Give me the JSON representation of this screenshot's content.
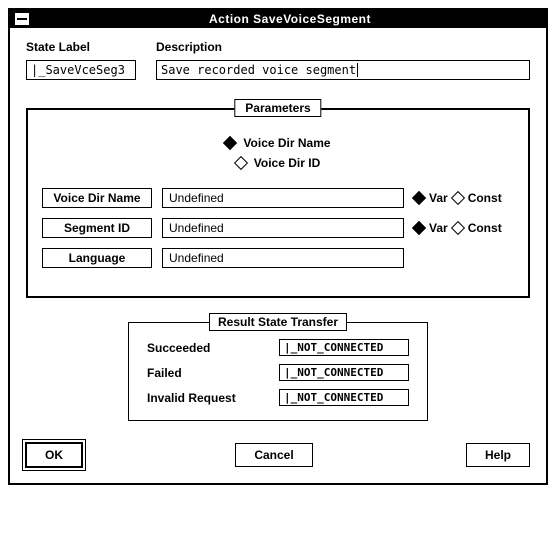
{
  "window": {
    "title": "Action SaveVoiceSegment"
  },
  "headers": {
    "state_label": "State Label",
    "description": "Description"
  },
  "fields": {
    "state_label_value": "|_SaveVceSeg3",
    "description_value": "Save recorded voice segment"
  },
  "parameters": {
    "group_title": "Parameters",
    "top_radios": {
      "name_label": "Voice Dir Name",
      "id_label": "Voice Dir ID"
    },
    "var_label": "Var",
    "const_label": "Const",
    "rows": {
      "voice_dir_name": {
        "label": "Voice Dir Name",
        "value": "Undefined"
      },
      "segment_id": {
        "label": "Segment ID",
        "value": "Undefined"
      },
      "language": {
        "label": "Language",
        "value": "Undefined"
      }
    }
  },
  "result": {
    "title": "Result State Transfer",
    "succeeded_label": "Succeeded",
    "failed_label": "Failed",
    "invalid_label": "Invalid Request",
    "succeeded_value": "|_NOT_CONNECTED",
    "failed_value": "|_NOT_CONNECTED",
    "invalid_value": "|_NOT_CONNECTED"
  },
  "buttons": {
    "ok": "OK",
    "cancel": "Cancel",
    "help": "Help"
  }
}
